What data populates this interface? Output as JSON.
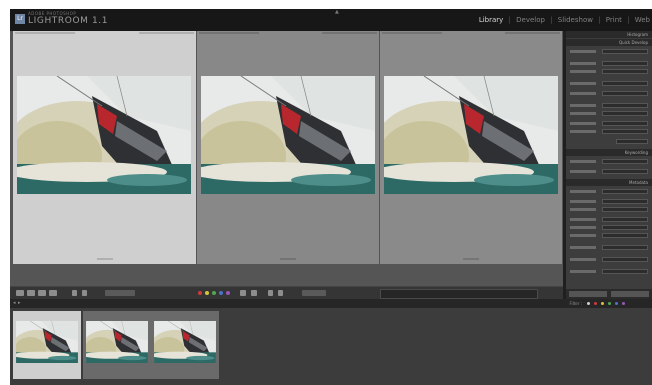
{
  "app": {
    "brand_small": "ADOBE PHOTOSHOP",
    "brand": "LIGHTROOM",
    "version": "1.1"
  },
  "header": {
    "center_mark": "▲",
    "modules": [
      {
        "label": "Library",
        "active": true
      },
      {
        "label": "Develop",
        "active": false
      },
      {
        "label": "Slideshow",
        "active": false
      },
      {
        "label": "Print",
        "active": false
      },
      {
        "label": "Web",
        "active": false
      }
    ]
  },
  "right_panel": {
    "sections": [
      "Histogram",
      "Quick Develop",
      "Keywording",
      "Metadata"
    ]
  },
  "filmstrip": {
    "nav_left": "◂",
    "nav_right": "▸",
    "filter_label": "Filter :"
  },
  "colors": {
    "accent": "#6f86a6",
    "label_red": "#d23a3a",
    "label_yellow": "#d8c43a",
    "label_green": "#4fa84f",
    "label_blue": "#4a74c9",
    "label_purple": "#9a56b8"
  }
}
